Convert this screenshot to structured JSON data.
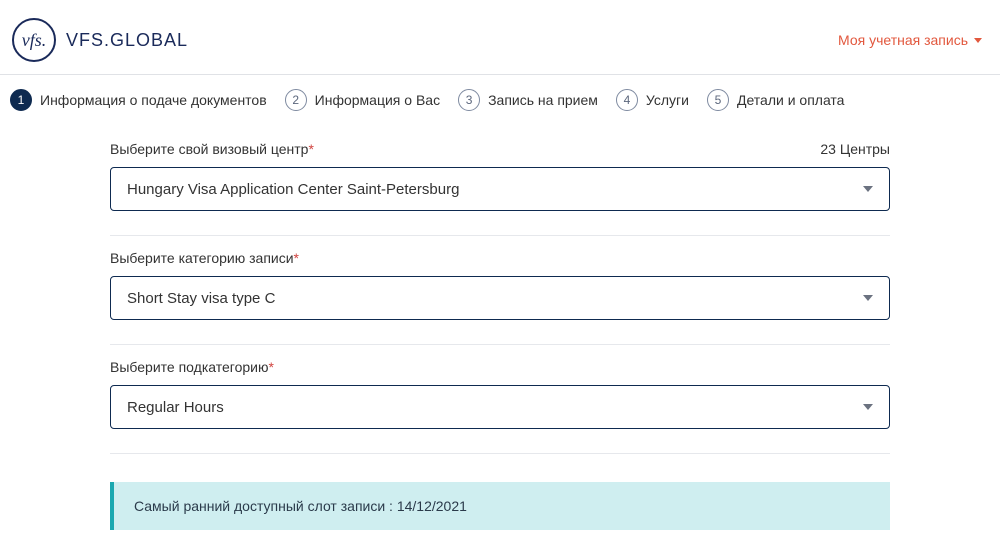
{
  "header": {
    "logo_mark": "vfs.",
    "logo_text": "VFS.GLOBAL",
    "account_label": "Моя учетная запись"
  },
  "stepper": {
    "active": 1,
    "steps": [
      {
        "num": "1",
        "label": "Информация о подаче документов"
      },
      {
        "num": "2",
        "label": "Информация о Вас"
      },
      {
        "num": "3",
        "label": "Запись на прием"
      },
      {
        "num": "4",
        "label": "Услуги"
      },
      {
        "num": "5",
        "label": "Детали и оплата"
      }
    ]
  },
  "form": {
    "center": {
      "label": "Выберите свой визовый центр",
      "required_mark": "*",
      "count_label": "23 Центры",
      "value": "Hungary Visa Application Center Saint-Petersburg"
    },
    "category": {
      "label": "Выберите категорию записи",
      "required_mark": "*",
      "value": "Short Stay visa type C"
    },
    "subcategory": {
      "label": "Выберите подкатегорию",
      "required_mark": "*",
      "value": "Regular Hours"
    }
  },
  "info": {
    "earliest_slot": "Самый ранний доступный слот записи : 14/12/2021"
  }
}
